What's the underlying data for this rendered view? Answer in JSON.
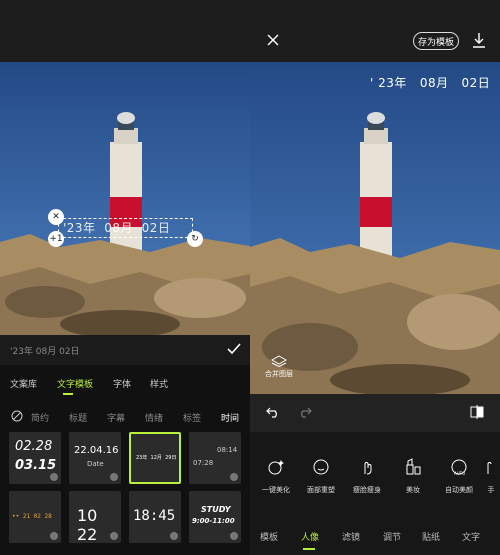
{
  "editor": {
    "date_text": "'23年  08月  02日",
    "input_text": "'23年 08月 02日",
    "handle_plus": "+1",
    "tabs": [
      "文案库",
      "文字模板",
      "字体",
      "样式"
    ],
    "active_tab": "文字模板",
    "subtabs": [
      "简约",
      "标题",
      "字幕",
      "情绪",
      "标签",
      "时间"
    ],
    "active_subtab": "时间",
    "templates": [
      {
        "line1": "02.28",
        "line2": "03.15"
      },
      {
        "line1": "22.04.16",
        "line2": "Date"
      },
      {
        "line1": "23年  12月  29日"
      },
      {
        "line1": "08:14",
        "line2": "07:28"
      },
      {
        "line1": "•• 21 02 28"
      },
      {
        "line1": "10 22"
      },
      {
        "line1": "18:45"
      },
      {
        "line1": "STUDY",
        "line2": "9:00-11:00"
      }
    ]
  },
  "preview": {
    "save_template": "存为模板",
    "date_text": "' 23年   08月   02日",
    "merge_label": "合并图层",
    "tools": [
      "一键美化",
      "面部重塑",
      "瘦脸瘦身",
      "美妆",
      "自动美颜",
      "手"
    ],
    "bottom_tabs": [
      "模板",
      "人像",
      "滤镜",
      "调节",
      "贴纸",
      "文字"
    ],
    "active_bottom_tab": "人像"
  },
  "colors": {
    "accent": "#b8f03c",
    "sky": "#2a4f88",
    "lighthouse_red": "#c8102e"
  }
}
